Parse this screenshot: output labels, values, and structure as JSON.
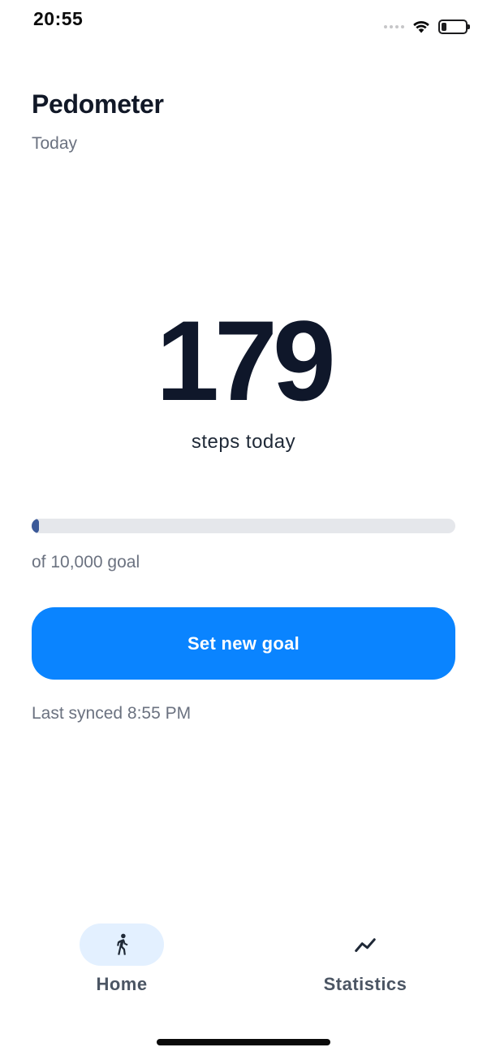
{
  "status_bar": {
    "time": "20:55",
    "icons": [
      "signal-dots-icon",
      "wifi-icon",
      "battery-icon"
    ],
    "battery_level": 0.2
  },
  "header": {
    "title": "Pedometer",
    "subtitle": "Today"
  },
  "steps": {
    "count": "179",
    "label": "steps today"
  },
  "progress": {
    "fraction": 0.0179,
    "goal_label": "of 10,000 goal"
  },
  "actions": {
    "set_goal_label": "Set new goal"
  },
  "sync": {
    "text": "Last synced 8:55 PM"
  },
  "tabs": [
    {
      "label": "Home",
      "icon": "walking-person-icon",
      "active": true
    },
    {
      "label": "Statistics",
      "icon": "trend-line-icon",
      "active": false
    }
  ],
  "colors": {
    "accent": "#0a84ff",
    "progress_fill": "#3b5998",
    "progress_track": "#e5e7eb",
    "active_tab_bg": "#e3f0ff"
  }
}
